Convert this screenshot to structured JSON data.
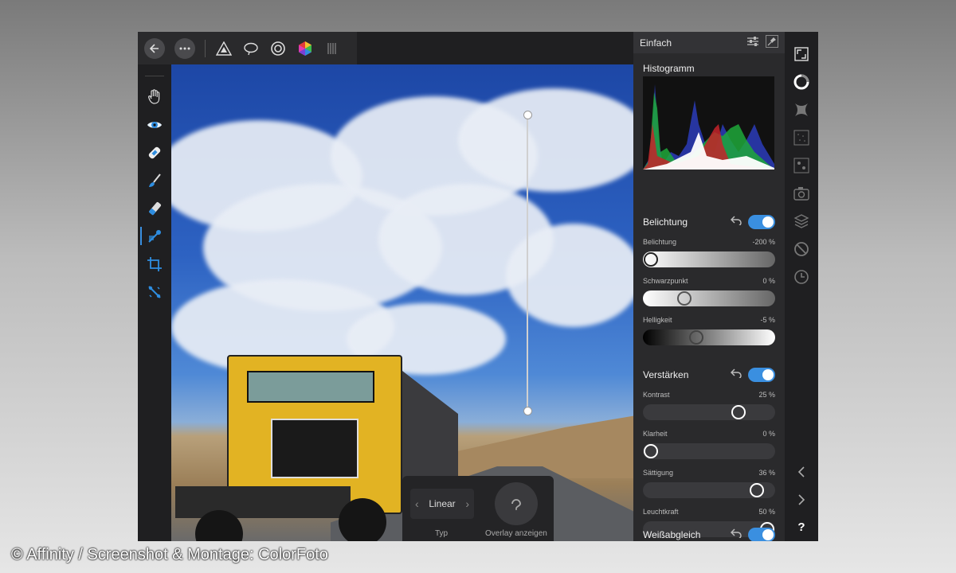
{
  "panel": {
    "title": "Einfach",
    "histogram_title": "Histogramm",
    "exposure": {
      "title": "Belichtung",
      "enabled": true,
      "sliders": [
        {
          "label": "Belichtung",
          "value": "-200 %",
          "position": 0.0
        },
        {
          "label": "Schwarzpunkt",
          "value": "0 %",
          "position": 0.3
        },
        {
          "label": "Helligkeit",
          "value": "-5 %",
          "position": 0.4
        }
      ]
    },
    "enhance": {
      "title": "Verstärken",
      "enabled": true,
      "sliders": [
        {
          "label": "Kontrast",
          "value": "25 %",
          "position": 0.73
        },
        {
          "label": "Klarheit",
          "value": "0 %",
          "position": 0.0
        },
        {
          "label": "Sättigung",
          "value": "36 %",
          "position": 0.87
        },
        {
          "label": "Leuchtkraft",
          "value": "50 %",
          "position": 0.96
        }
      ]
    },
    "white_balance": {
      "title": "Weißabgleich",
      "enabled": true
    }
  },
  "overlay": {
    "type_value": "Linear",
    "type_label": "Typ",
    "show_overlay_label": "Overlay anzeigen"
  },
  "toolbar": {
    "icons": [
      "back-icon",
      "more-icon",
      "develop-persona-icon",
      "selection-icon",
      "tone-map-icon",
      "color-persona-icon",
      "export-icon"
    ]
  },
  "left_tools": [
    "hand-icon",
    "red-eye-icon",
    "blemish-icon",
    "brush-icon",
    "eraser-icon",
    "gradient-icon",
    "crop-icon",
    "overlay-icon"
  ],
  "right_rail": [
    "fullscreen-icon",
    "basic-icon",
    "tones-icon",
    "details-icon",
    "lens-icon",
    "camera-icon",
    "layers-icon",
    "no-icon",
    "history-icon"
  ],
  "credit": "© Affinity / Screenshot & Montage: ColorFoto",
  "colors": {
    "accent": "#3a8fe0",
    "panel_bg": "#2a2a2c",
    "app_bg": "#1f1f21"
  }
}
